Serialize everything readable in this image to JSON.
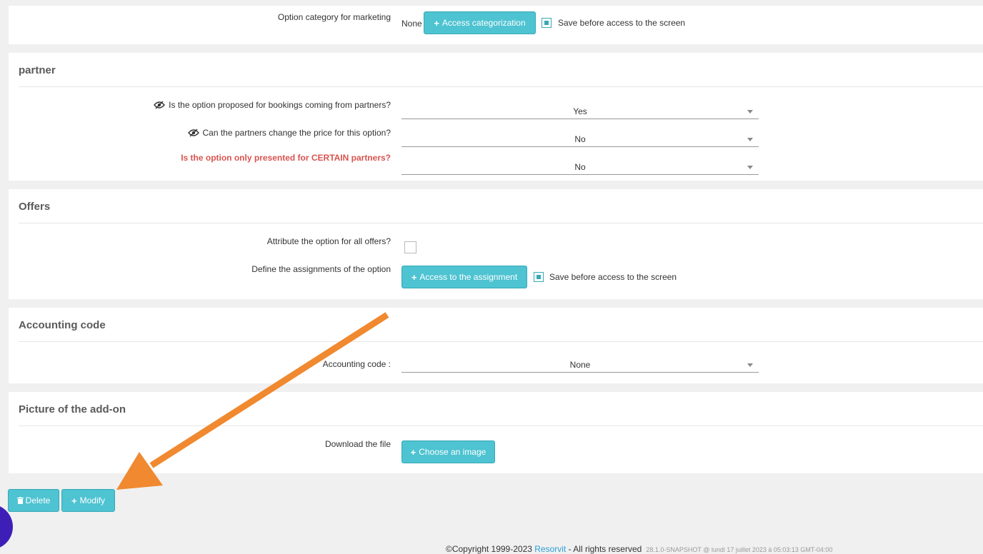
{
  "marketing": {
    "label": "Option category for marketing",
    "value": "None",
    "button": "Access categorization",
    "save_checkbox_label": "Save before access to the screen"
  },
  "partner": {
    "title": "partner",
    "q1_label": "Is the option proposed for bookings coming from partners?",
    "q1_value": "Yes",
    "q2_label": "Can the partners change the price for this option?",
    "q2_value": "No",
    "q3_label": "Is the option only presented for CERTAIN partners?",
    "q3_value": "No"
  },
  "offers": {
    "title": "Offers",
    "all_offers_label": "Attribute the option for all offers?",
    "assign_label": "Define the assignments of the option",
    "assign_button": "Access to the assignment",
    "save_checkbox_label": "Save before access to the screen"
  },
  "accounting": {
    "title": "Accounting code",
    "label": "Accounting code :",
    "value": "None"
  },
  "picture": {
    "title": "Picture of the add-on",
    "label": "Download the file",
    "button": "Choose an image"
  },
  "actions": {
    "delete": "Delete",
    "modify": "Modify"
  },
  "footer": {
    "prefix": "©Copyright 1999-2023 ",
    "brand": "Resorvit",
    "suffix": " - All rights reserved",
    "version": "28.1.0-SNAPSHOT @ lundi 17 juillet 2023 à 05:03:13 GMT-04:00"
  },
  "colors": {
    "accent": "#4ec3d1",
    "warning_text": "#d9534f",
    "arrow": "#f0892f"
  }
}
